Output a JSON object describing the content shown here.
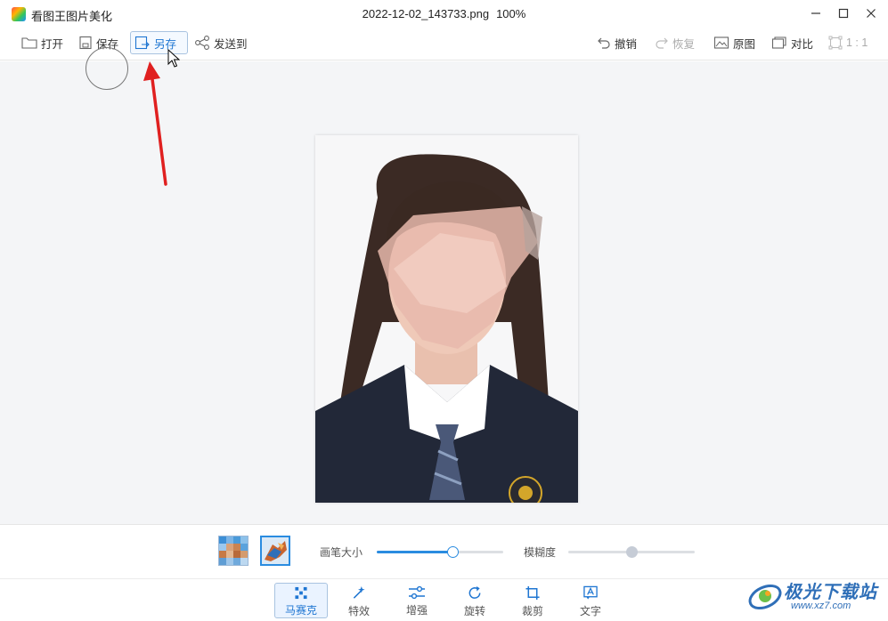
{
  "window": {
    "app_title": "看图王图片美化",
    "file_name": "2022-12-02_143733.png",
    "zoom": "100%",
    "minimize_glyph": "—",
    "maximize_glyph": "☐",
    "close_glyph": "✕"
  },
  "toolbar": {
    "open": "打开",
    "save": "保存",
    "save_as": "另存",
    "send_to": "发送到",
    "undo": "撤销",
    "redo": "恢复",
    "original": "原图",
    "compare": "对比",
    "ratio": "1 : 1"
  },
  "panel": {
    "brush_size_label": "画笔大小",
    "brush_size_value": 0.6,
    "blur_label": "模糊度",
    "blur_value": 0.5
  },
  "tools": [
    {
      "label": "马赛克",
      "icon": "mosaic-icon",
      "active": true
    },
    {
      "label": "特效",
      "icon": "magic-wand-icon",
      "active": false
    },
    {
      "label": "增强",
      "icon": "sliders-icon",
      "active": false
    },
    {
      "label": "旋转",
      "icon": "rotate-icon",
      "active": false
    },
    {
      "label": "裁剪",
      "icon": "crop-icon",
      "active": false
    },
    {
      "label": "文字",
      "icon": "text-icon",
      "active": false
    }
  ],
  "watermark": {
    "name": "极光下载站",
    "url": "www.xz7.com"
  },
  "colors": {
    "accent": "#2a8ce0",
    "arrow": "#e02020",
    "canvas_bg": "#f4f5f7"
  }
}
